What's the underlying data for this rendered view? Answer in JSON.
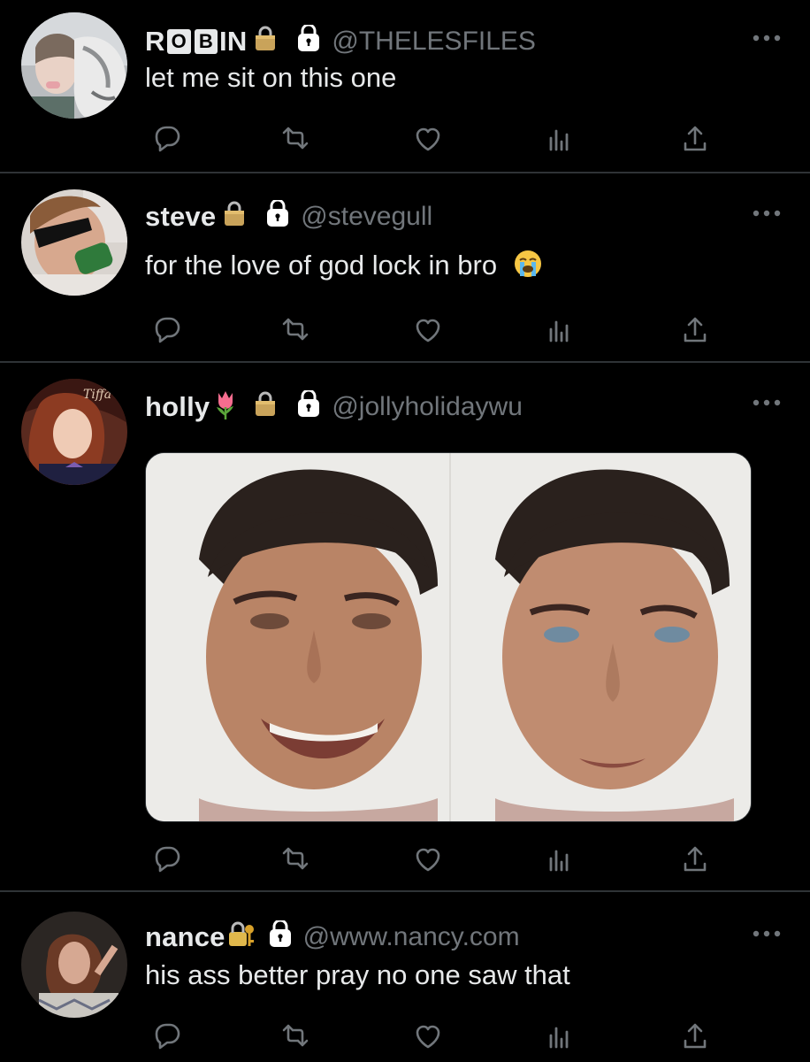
{
  "tweets": [
    {
      "name": "ROBIN",
      "name_parts": [
        "R",
        "O",
        "B",
        "IN"
      ],
      "handle": "@THELESFILES",
      "text": "let me sit on this one",
      "avatar_icon": "avatar-photo"
    },
    {
      "name": "steve",
      "handle": "@stevegull",
      "text": "for the love of god lock in bro",
      "text_emoji": "loudly-crying-face-icon",
      "avatar_icon": "avatar-photo"
    },
    {
      "name": "holly",
      "name_emoji": "tulip-icon",
      "handle": "@jollyholidaywu",
      "text": "",
      "has_media": true,
      "avatar_icon": "avatar-photo"
    },
    {
      "name": "nance",
      "name_emoji": "locked-with-key-icon",
      "handle": "@www.nancy.com",
      "text": "his ass better pray no one saw that",
      "avatar_icon": "avatar-photo"
    }
  ],
  "actions": [
    "reply-icon",
    "retweet-icon",
    "like-icon",
    "analytics-icon",
    "share-icon"
  ],
  "colors": {
    "background": "#000000",
    "text": "#e7e9ea",
    "secondary": "#71767b",
    "divider": "#2f3336"
  }
}
